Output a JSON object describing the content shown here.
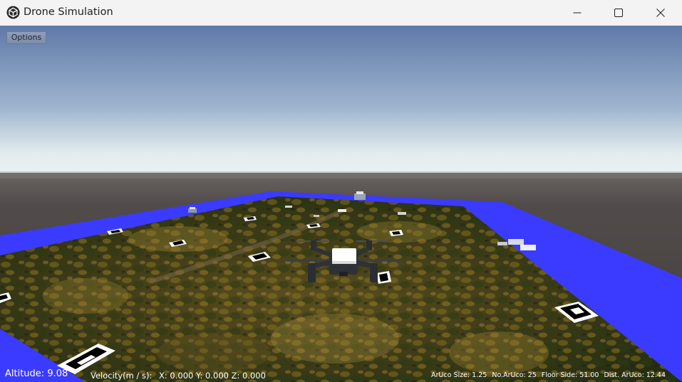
{
  "window": {
    "title": "Drone Simulation",
    "app_icon": "unity-cube-icon",
    "controls": {
      "minimize": "minimize-icon",
      "maximize": "maximize-icon",
      "close": "close-icon"
    }
  },
  "toolbar": {
    "options_label": "Options"
  },
  "hud": {
    "altitude": "Altitude: 9.08",
    "velocity_label": "Velocity(m / s):",
    "velocity_x": "X: 0.000",
    "velocity_y": "Y: 0.000",
    "velocity_z": "Z: 0.000",
    "aruco_size": "ArUco Size: 1.25",
    "aruco_count": "No.ArUco: 25",
    "floor_side": "Floor Side: 51.00",
    "dist_aruco": "Dist. ArUco: 12.44"
  },
  "scene": {
    "sky_top_color": "#5f79a9",
    "sky_horizon_color": "#eaf1f3",
    "ground_color": "#4a4544",
    "border_color": "#3b3bff",
    "forest_color": "#3c3a17",
    "drone_body_color": "#2e3236",
    "drone_battery_color": "#ffffff"
  }
}
